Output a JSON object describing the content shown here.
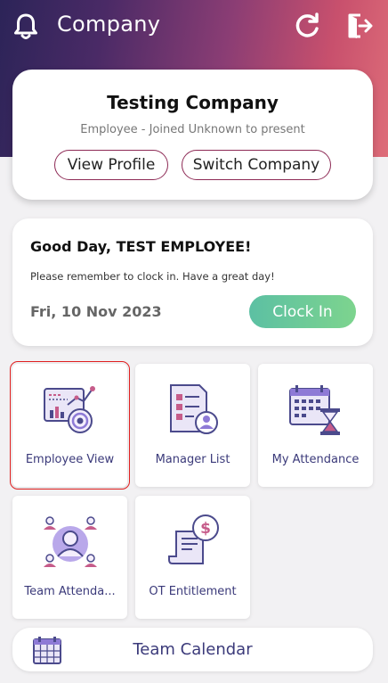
{
  "header": {
    "title": "Company",
    "icons": [
      "bell-icon",
      "refresh-icon",
      "logout-icon"
    ]
  },
  "company_card": {
    "name": "Testing Company",
    "subtitle": "Employee - Joined Unknown to present",
    "view_profile_label": "View Profile",
    "switch_company_label": "Switch Company"
  },
  "greeting": {
    "title": "Good Day, TEST EMPLOYEE!",
    "message": "Please remember to clock in. Have a great day!",
    "date": "Fri, 10 Nov 2023",
    "clock_in_label": "Clock In"
  },
  "tiles": [
    {
      "label": "Employee View",
      "icon": "employee-view-icon",
      "selected": true
    },
    {
      "label": "Manager List",
      "icon": "manager-list-icon"
    },
    {
      "label": "My Attendance",
      "icon": "my-attendance-icon"
    },
    {
      "label": "Team Attenda...",
      "icon": "team-attendance-icon"
    },
    {
      "label": "OT Entitlement",
      "icon": "ot-entitlement-icon"
    }
  ],
  "team_calendar": {
    "label": "Team Calendar",
    "icon": "calendar-icon"
  },
  "colors": {
    "accent_purple": "#3b3a7a",
    "clock_green": "#6cc99a",
    "pill_border": "#8d2a55",
    "selection_red": "#e02020"
  }
}
